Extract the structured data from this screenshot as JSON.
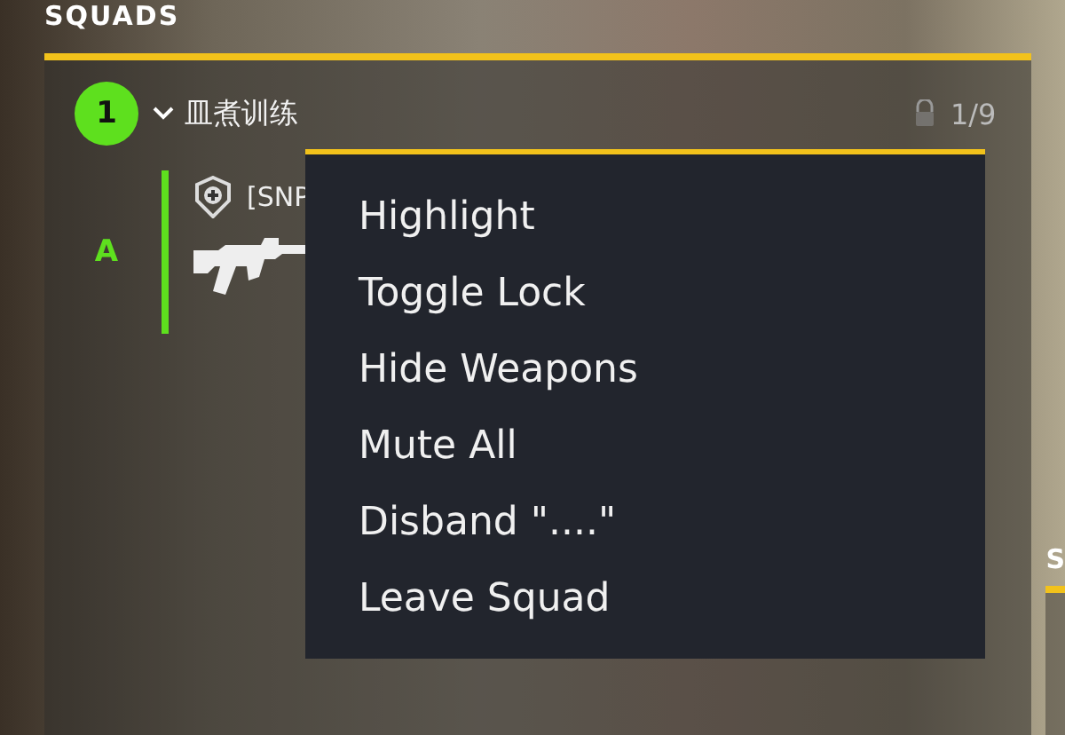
{
  "panel": {
    "title": "SQUADS"
  },
  "squads": [
    {
      "number": "1",
      "expanded": true,
      "name": "皿煮训练",
      "count": "1/9",
      "members": [
        {
          "team": "A",
          "name": "[SNP"
        }
      ]
    }
  ],
  "context_menu": {
    "items": [
      {
        "label": "Highlight"
      },
      {
        "label": "Toggle Lock"
      },
      {
        "label": "Hide Weapons"
      },
      {
        "label": "Mute All"
      },
      {
        "label": "Disband \"....\""
      },
      {
        "label": "Leave Squad"
      }
    ]
  },
  "side_panel": {
    "title": "S"
  }
}
